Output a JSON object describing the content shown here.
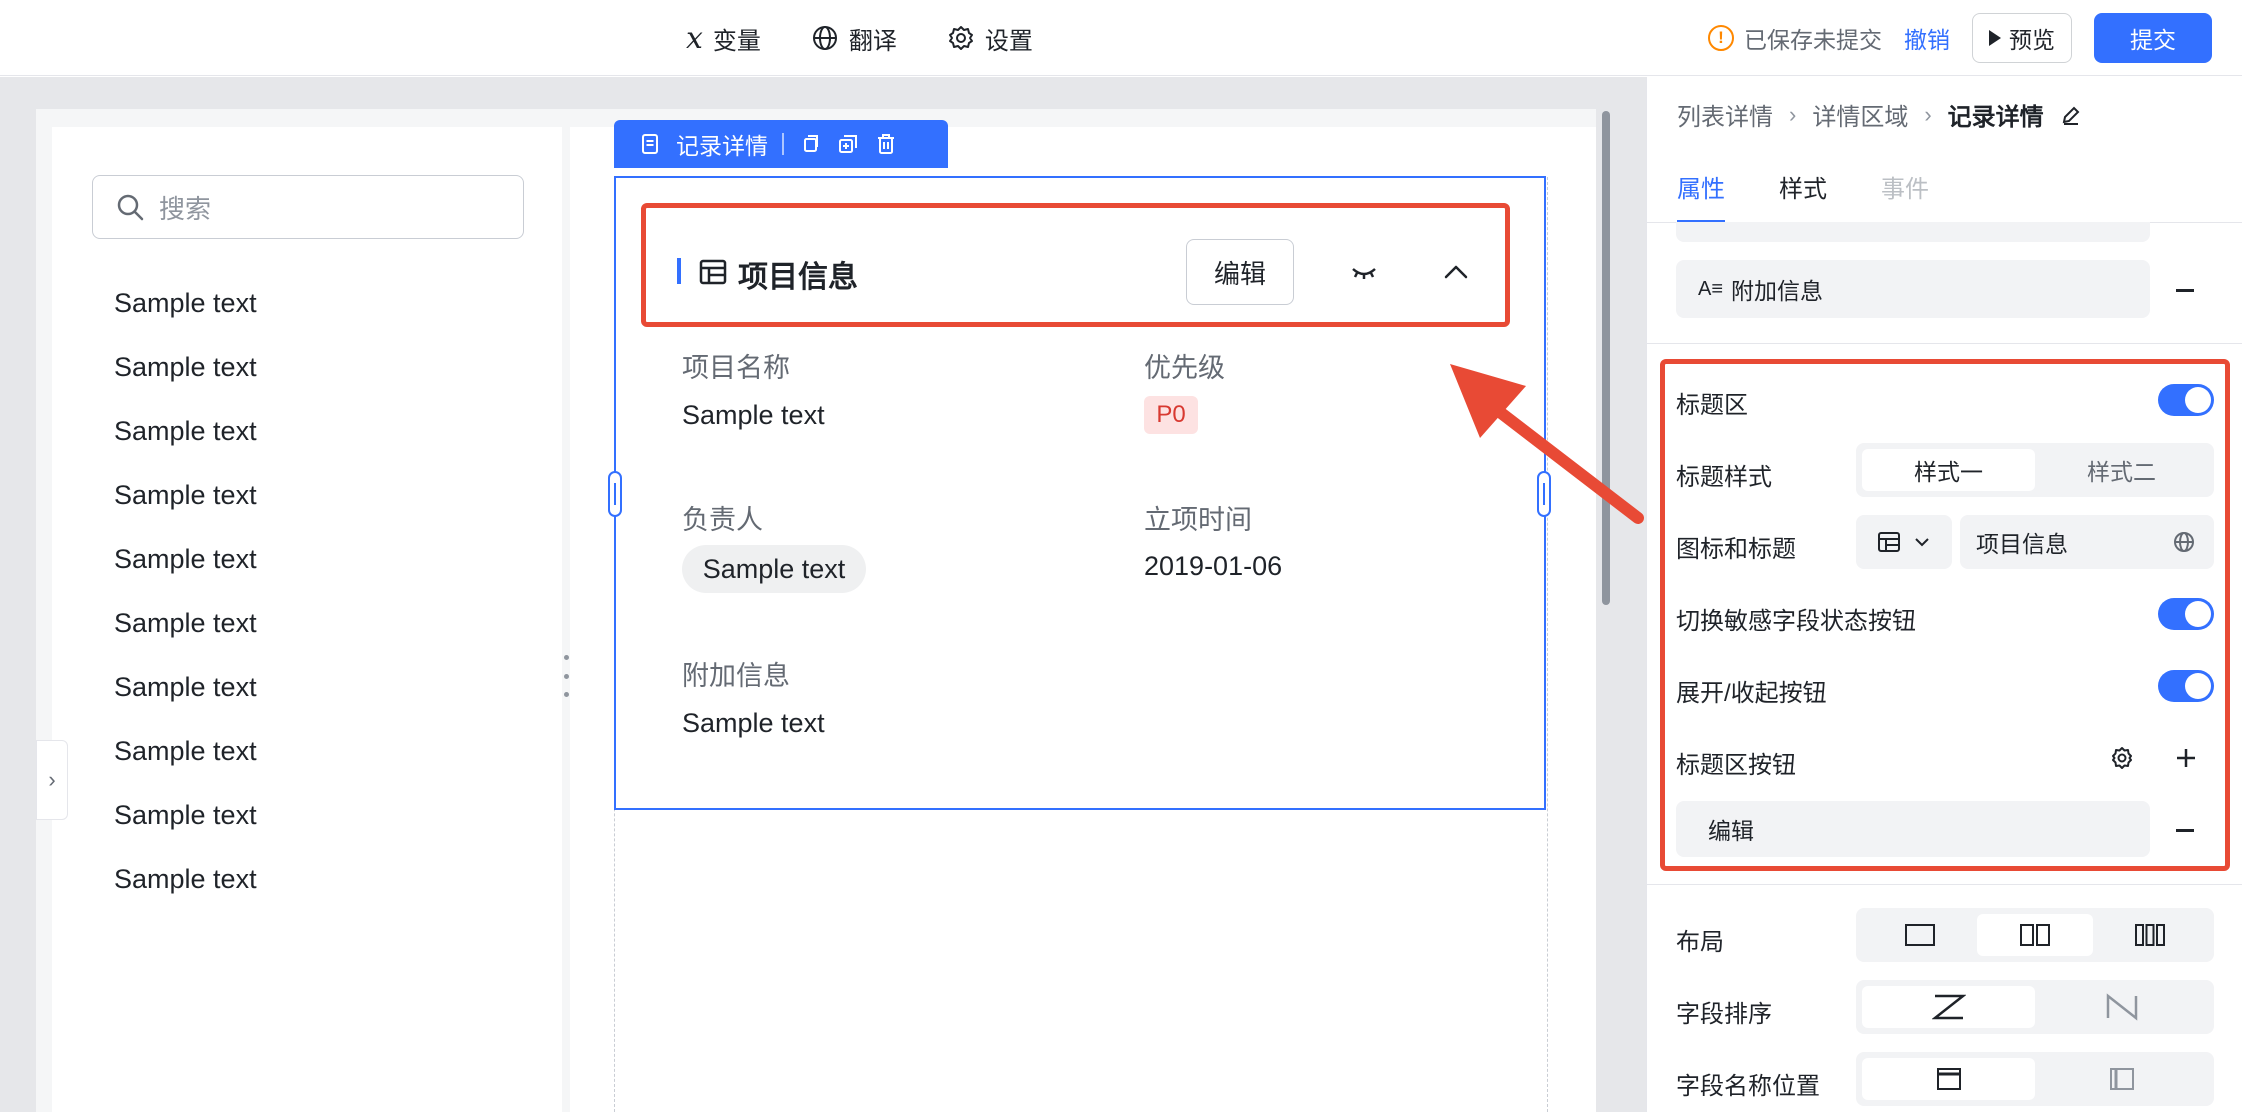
{
  "topbar": {
    "variables_label": "变量",
    "translate_label": "翻译",
    "settings_label": "设置",
    "status_text": "已保存未提交",
    "undo_label": "撤销",
    "preview_label": "预览",
    "submit_label": "提交"
  },
  "left_panel": {
    "search_placeholder": "搜索",
    "items": [
      "Sample text",
      "Sample text",
      "Sample text",
      "Sample text",
      "Sample text",
      "Sample text",
      "Sample text",
      "Sample text",
      "Sample text",
      "Sample text"
    ]
  },
  "component": {
    "toolbar_label": "记录详情",
    "title": "项目信息",
    "edit_button": "编辑",
    "fields": {
      "project_name_label": "项目名称",
      "project_name_value": "Sample text",
      "priority_label": "优先级",
      "priority_value": "P0",
      "owner_label": "负责人",
      "owner_value": "Sample text",
      "start_date_label": "立项时间",
      "start_date_value": "2019-01-06",
      "extra_label": "附加信息",
      "extra_value": "Sample text"
    }
  },
  "sidebar": {
    "breadcrumb": [
      "列表详情",
      "详情区域",
      "记录详情"
    ],
    "tabs": [
      "属性",
      "样式",
      "事件"
    ],
    "extra_info_item": "附加信息",
    "title_area_label": "标题区",
    "title_style_label": "标题样式",
    "title_style_options": [
      "样式一",
      "样式二"
    ],
    "icon_title_label": "图标和标题",
    "icon_title_value": "项目信息",
    "sensitive_toggle_label": "切换敏感字段状态按钮",
    "expand_toggle_label": "展开/收起按钮",
    "title_buttons_label": "标题区按钮",
    "title_button_item": "编辑",
    "layout_label": "布局",
    "field_order_label": "字段排序",
    "field_name_pos_label": "字段名称位置"
  },
  "colors": {
    "accent": "#3370ff",
    "highlight": "#e84a35",
    "warning": "#ff8800"
  }
}
